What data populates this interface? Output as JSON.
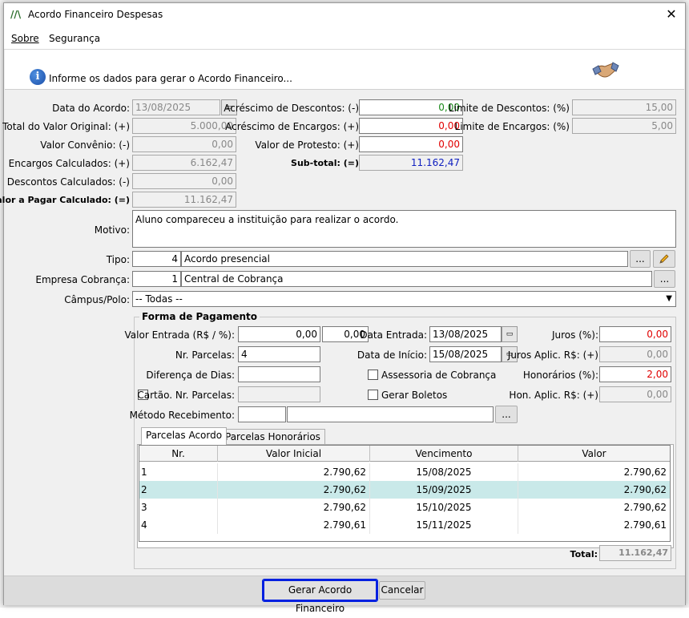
{
  "window": {
    "title": "Acordo Financeiro Despesas",
    "close": "✕"
  },
  "menu": [
    "Sobre",
    "Segurança"
  ],
  "header": {
    "text": "Informe os dados para gerar o Acordo Financeiro..."
  },
  "fields": {
    "data_acordo": {
      "label": "Data do Acordo:",
      "value": "13/08/2025"
    },
    "total_original": {
      "label": "Total do Valor Original: (+)",
      "value": "5.000,00"
    },
    "valor_convenio": {
      "label": "Valor Convênio: (-)",
      "value": "0,00"
    },
    "encargos_calc": {
      "label": "Encargos Calculados: (+)",
      "value": "6.162,47"
    },
    "descontos_calc": {
      "label": "Descontos Calculados: (-)",
      "value": "0,00"
    },
    "valor_pagar": {
      "label": "Valor a Pagar Calculado: (=)",
      "value": "11.162,47"
    },
    "acresc_descontos": {
      "label": "Acréscimo de Descontos: (-)",
      "value": "0,00"
    },
    "acresc_encargos": {
      "label": "Acréscimo de Encargos: (+)",
      "value": "0,00"
    },
    "valor_protesto": {
      "label": "Valor de Protesto: (+)",
      "value": "0,00"
    },
    "subtotal": {
      "label": "Sub-total: (=)",
      "value": "11.162,47"
    },
    "limite_descontos": {
      "label": "Limite de Descontos: (%)",
      "value": "15,00"
    },
    "limite_encargos": {
      "label": "Limite de Encargos: (%)",
      "value": "5,00"
    },
    "motivo": {
      "label": "Motivo:",
      "value": "Aluno compareceu a instituição para realizar o acordo."
    },
    "tipo": {
      "label": "Tipo:",
      "code": "4",
      "value": "Acordo presencial"
    },
    "empresa": {
      "label": "Empresa Cobrança:",
      "code": "1",
      "value": "Central de Cobrança"
    },
    "campus": {
      "label": "Câmpus/Polo:",
      "value": "-- Todas --"
    }
  },
  "pagamento": {
    "title": "Forma de Pagamento",
    "valor_entrada_label": "Valor Entrada (R$ / %):",
    "valor_entrada_rs": "0,00",
    "valor_entrada_pct": "0,00",
    "nr_parcelas_label": "Nr. Parcelas:",
    "nr_parcelas": "4",
    "diferenca_dias_label": "Diferença de Dias:",
    "diferenca_dias": "",
    "cartao_label": "Cartão. Nr. Parcelas:",
    "metodo_label": "Método Recebimento:",
    "data_entrada_label": "Data Entrada:",
    "data_entrada": "13/08/2025",
    "data_inicio_label": "Data de Início:",
    "data_inicio": "15/08/2025",
    "assessoria_label": "Assessoria de Cobrança",
    "gerar_boletos_label": "Gerar Boletos",
    "juros_label": "Juros (%):",
    "juros": "0,00",
    "juros_aplic_label": "Juros Aplic. R$: (+)",
    "juros_aplic": "0,00",
    "honorarios_label": "Honorários (%):",
    "honorarios": "2,00",
    "hon_aplic_label": "Hon. Aplic. R$: (+)",
    "hon_aplic": "0,00"
  },
  "tabs": [
    "Parcelas Acordo",
    "Parcelas Honorários"
  ],
  "grid": {
    "columns": [
      "Nr.",
      "Valor Inicial",
      "Vencimento",
      "Valor"
    ],
    "rows": [
      {
        "nr": "1",
        "valor_inicial": "2.790,62",
        "vencimento": "15/08/2025",
        "valor": "2.790,62"
      },
      {
        "nr": "2",
        "valor_inicial": "2.790,62",
        "vencimento": "15/09/2025",
        "valor": "2.790,62"
      },
      {
        "nr": "3",
        "valor_inicial": "2.790,62",
        "vencimento": "15/10/2025",
        "valor": "2.790,62"
      },
      {
        "nr": "4",
        "valor_inicial": "2.790,61",
        "vencimento": "15/11/2025",
        "valor": "2.790,61"
      }
    ],
    "total_label": "Total:",
    "total": "11.162,47"
  },
  "buttons": {
    "ellipsis": "...",
    "gerar": "Gerar Acordo Financeiro",
    "cancelar": "Cancelar"
  },
  "colors": {
    "primary_border": "#0020e0",
    "selected_row": "#c9e9e9",
    "red_value": "#e00000",
    "green_value": "#1a8a1a"
  }
}
